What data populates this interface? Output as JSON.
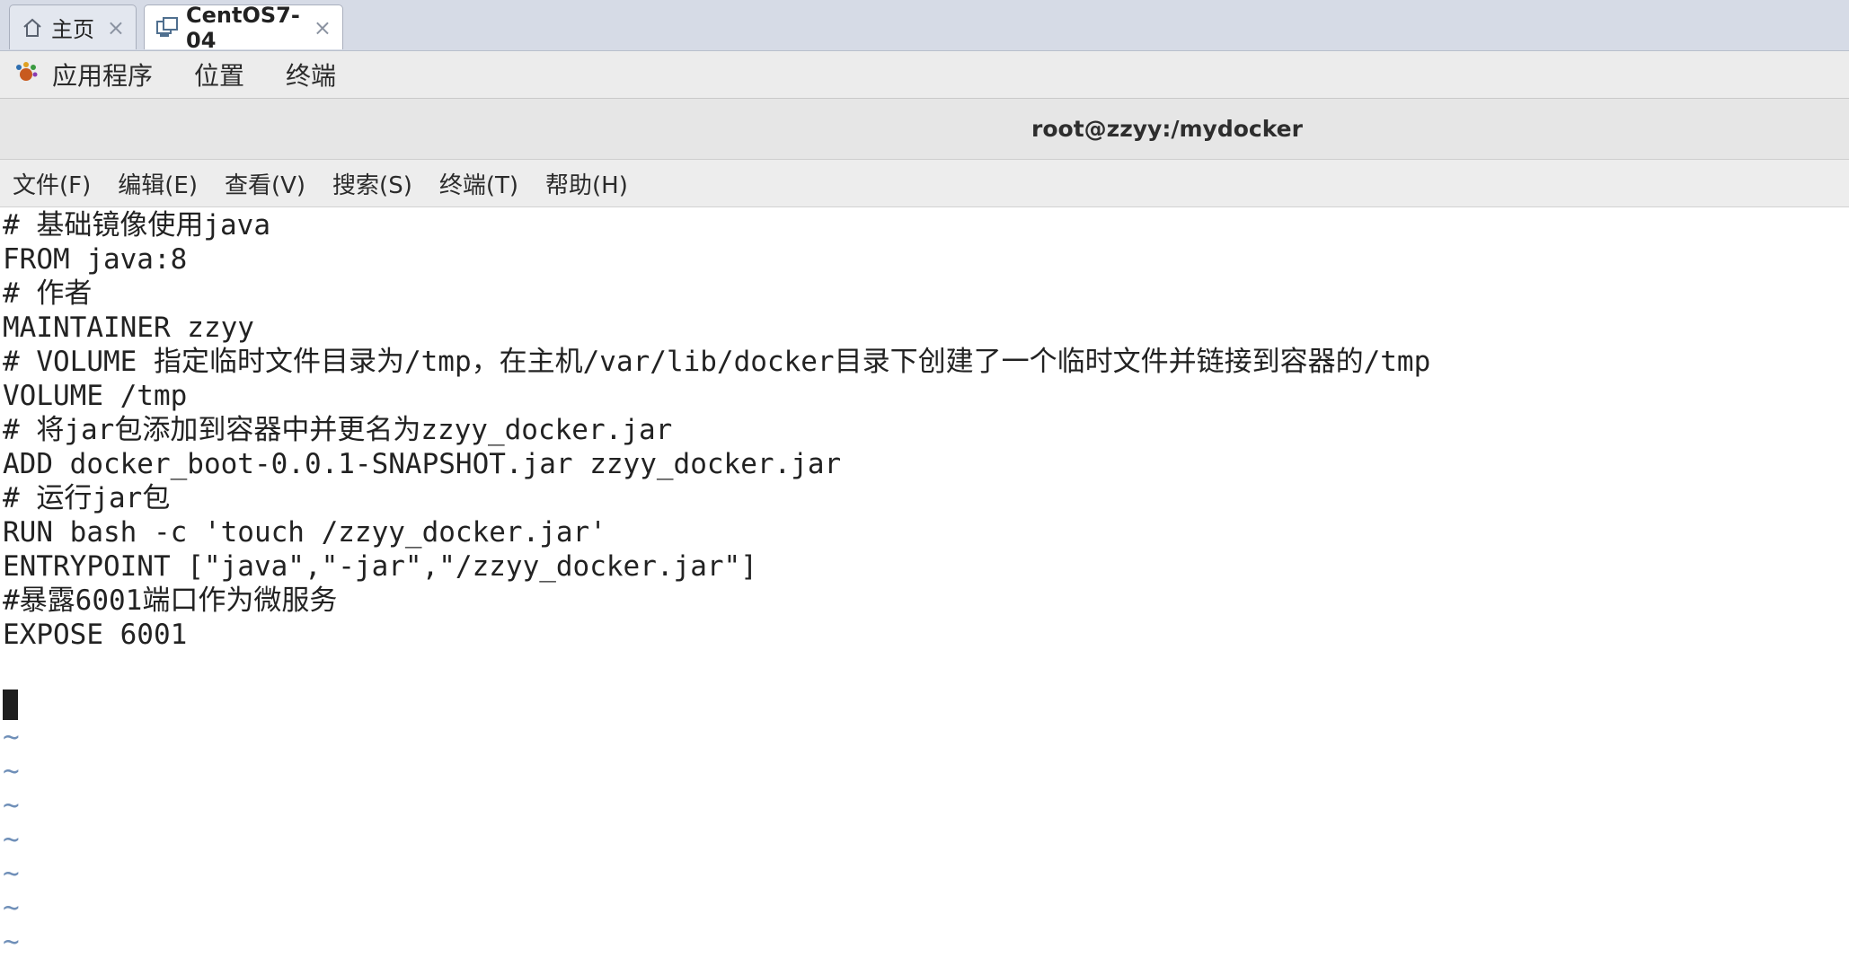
{
  "tabs": [
    {
      "label": "主页",
      "close": "×",
      "icon": "home-icon"
    },
    {
      "label": "CentOS7-04",
      "close": "×",
      "icon": "vm-icon"
    }
  ],
  "appbar": {
    "icon": "gnome-foot-icon",
    "items": [
      "应用程序",
      "位置",
      "终端"
    ]
  },
  "window": {
    "title": "root@zzyy:/mydocker"
  },
  "menu": [
    "文件(F)",
    "编辑(E)",
    "查看(V)",
    "搜索(S)",
    "终端(T)",
    "帮助(H)"
  ],
  "content": {
    "lines": [
      "# 基础镜像使用java",
      "FROM java:8",
      "# 作者",
      "MAINTAINER zzyy",
      "# VOLUME 指定临时文件目录为/tmp，在主机/var/lib/docker目录下创建了一个临时文件并链接到容器的/tmp",
      "VOLUME /tmp",
      "# 将jar包添加到容器中并更名为zzyy_docker.jar",
      "ADD docker_boot-0.0.1-SNAPSHOT.jar zzyy_docker.jar",
      "# 运行jar包",
      "RUN bash -c 'touch /zzyy_docker.jar'",
      "ENTRYPOINT [\"java\",\"-jar\",\"/zzyy_docker.jar\"]",
      "#暴露6001端口作为微服务",
      "EXPOSE 6001",
      ""
    ],
    "tilde": "~"
  }
}
